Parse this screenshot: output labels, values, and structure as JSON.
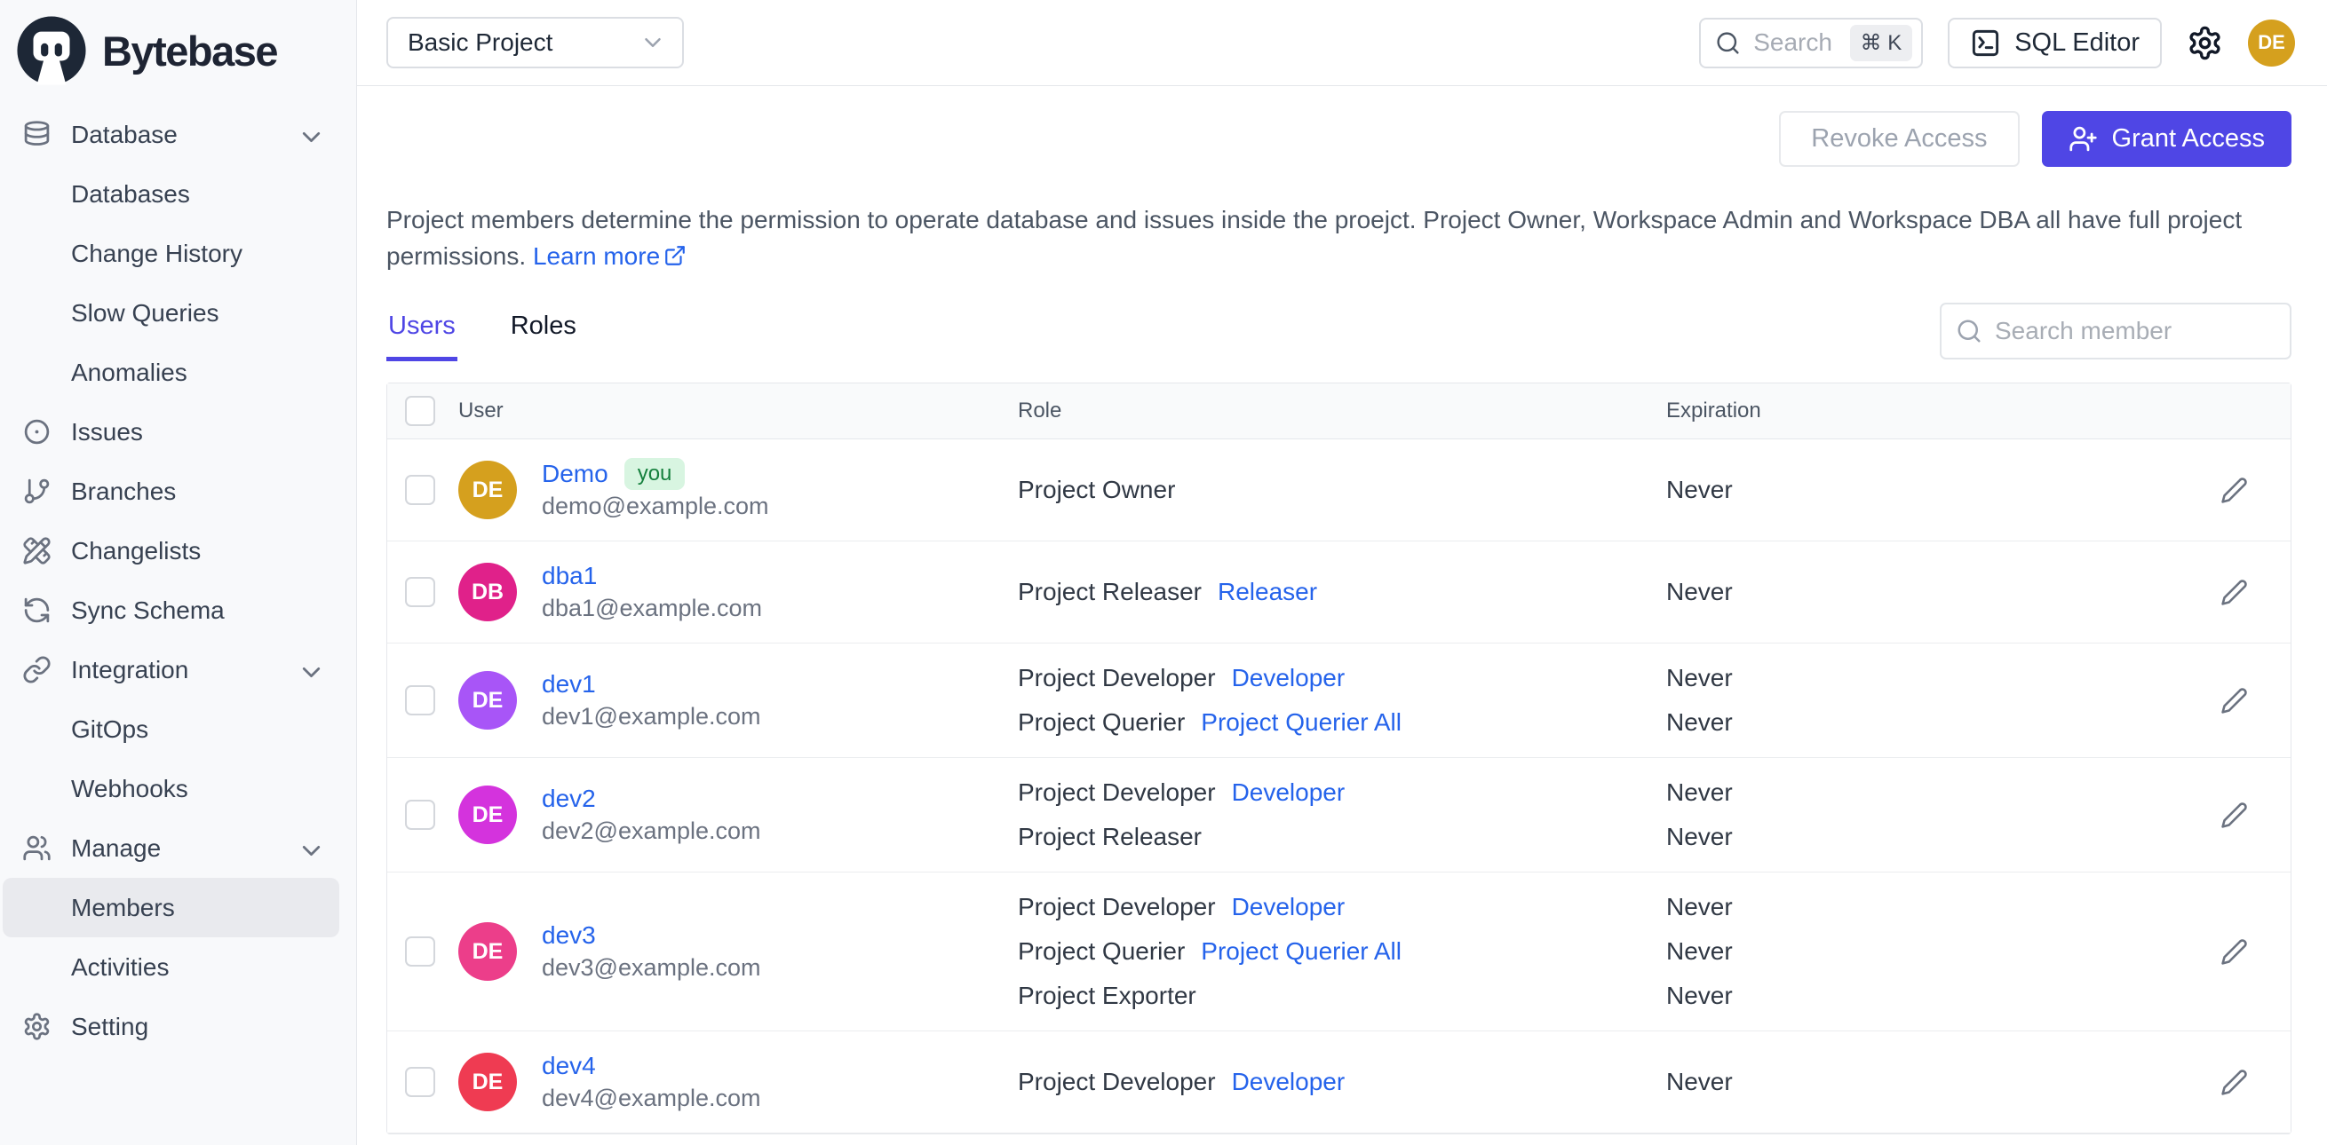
{
  "brand": {
    "name": "Bytebase"
  },
  "topbar": {
    "project_selector": "Basic Project",
    "search_placeholder": "Search",
    "search_shortcut": "⌘ K",
    "sql_editor_label": "SQL Editor",
    "avatar_initials": "DE"
  },
  "sidebar": {
    "items": [
      {
        "label": "Database",
        "icon": "database-icon",
        "chevron": true
      },
      {
        "label": "Databases",
        "indent": true
      },
      {
        "label": "Change History",
        "indent": true
      },
      {
        "label": "Slow Queries",
        "indent": true
      },
      {
        "label": "Anomalies",
        "indent": true
      },
      {
        "label": "Issues",
        "icon": "issue-icon"
      },
      {
        "label": "Branches",
        "icon": "branch-icon"
      },
      {
        "label": "Changelists",
        "icon": "changelist-icon"
      },
      {
        "label": "Sync Schema",
        "icon": "sync-icon"
      },
      {
        "label": "Integration",
        "icon": "link-icon",
        "chevron": true
      },
      {
        "label": "GitOps",
        "indent": true
      },
      {
        "label": "Webhooks",
        "indent": true
      },
      {
        "label": "Manage",
        "icon": "users-icon",
        "chevron": true
      },
      {
        "label": "Members",
        "indent": true,
        "selected": true
      },
      {
        "label": "Activities",
        "indent": true
      },
      {
        "label": "Setting",
        "icon": "gear-icon"
      }
    ]
  },
  "members": {
    "revoke_label": "Revoke Access",
    "grant_label": "Grant Access",
    "description": "Project members determine the permission to operate database and issues inside the proejct. Project Owner, Workspace Admin and Workspace DBA all have full project permissions.",
    "learn_more_label": "Learn more",
    "search_placeholder": "Search member",
    "tabs": [
      {
        "label": "Users",
        "active": true
      },
      {
        "label": "Roles",
        "active": false
      }
    ],
    "table": {
      "columns": [
        "User",
        "Role",
        "Expiration"
      ],
      "rows": [
        {
          "name": "Demo",
          "you_badge": "you",
          "email": "demo@example.com",
          "initials": "DE",
          "avatar_color": "#d5a01e",
          "roles": [
            {
              "role": "Project Owner",
              "link": null,
              "expiration": "Never"
            }
          ]
        },
        {
          "name": "dba1",
          "email": "dba1@example.com",
          "initials": "DB",
          "avatar_color": "#e0218a",
          "roles": [
            {
              "role": "Project Releaser",
              "link": "Releaser",
              "expiration": "Never"
            }
          ]
        },
        {
          "name": "dev1",
          "email": "dev1@example.com",
          "initials": "DE",
          "avatar_color": "#a855f7",
          "roles": [
            {
              "role": "Project Developer",
              "link": "Developer",
              "expiration": "Never"
            },
            {
              "role": "Project Querier",
              "link": "Project Querier All",
              "expiration": "Never"
            }
          ]
        },
        {
          "name": "dev2",
          "email": "dev2@example.com",
          "initials": "DE",
          "avatar_color": "#d433dd",
          "roles": [
            {
              "role": "Project Developer",
              "link": "Developer",
              "expiration": "Never"
            },
            {
              "role": "Project Releaser",
              "link": null,
              "expiration": "Never"
            }
          ]
        },
        {
          "name": "dev3",
          "email": "dev3@example.com",
          "initials": "DE",
          "avatar_color": "#ec3e8a",
          "roles": [
            {
              "role": "Project Developer",
              "link": "Developer",
              "expiration": "Never"
            },
            {
              "role": "Project Querier",
              "link": "Project Querier All",
              "expiration": "Never"
            },
            {
              "role": "Project Exporter",
              "link": null,
              "expiration": "Never"
            }
          ]
        },
        {
          "name": "dev4",
          "email": "dev4@example.com",
          "initials": "DE",
          "avatar_color": "#ef3b52",
          "roles": [
            {
              "role": "Project Developer",
              "link": "Developer",
              "expiration": "Never"
            }
          ]
        }
      ]
    }
  },
  "colors": {
    "accent": "#4f46e5",
    "link": "#2563eb",
    "you_badge_bg": "#d8f5e1",
    "you_badge_text": "#15803d",
    "sidebar_bg": "#f8f9fb",
    "border": "#e5e7eb"
  }
}
